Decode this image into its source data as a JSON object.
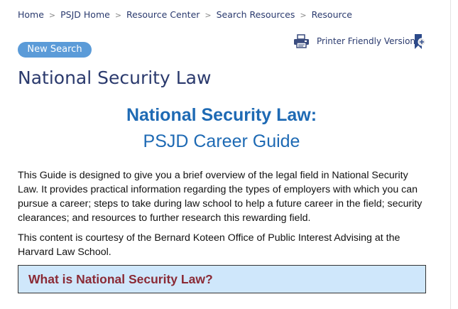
{
  "breadcrumb": {
    "items": [
      {
        "label": "Home"
      },
      {
        "label": "PSJD Home"
      },
      {
        "label": "Resource Center"
      },
      {
        "label": "Search Resources"
      },
      {
        "label": "Resource"
      }
    ],
    "separator": ">"
  },
  "toolbar": {
    "new_search_label": "New Search",
    "printer_label": "Printer Friendly Version",
    "printer_icon": "printer-icon",
    "bookmark_icon": "bookmark-icon"
  },
  "page": {
    "title": "National Security Law"
  },
  "guide": {
    "title": "National Security Law:",
    "subtitle": "PSJD Career Guide",
    "paragraphs": [
      "This Guide is designed to give you a brief overview of the legal field in National Security Law. It provides practical information regarding the types of employers with which you can pursue a career; steps to take during law school to help a future career in the field; security clearances; and resources to further research this rewarding field.",
      "This content is courtesy of the Bernard Koteen Office of Public Interest Advising at the Harvard Law School."
    ],
    "section_heading": "What is National Security Law?"
  },
  "colors": {
    "link": "#2a3a6e",
    "button": "#5b9bd8",
    "guide_title": "#1e6ab4",
    "section_bg": "#cfe7fb",
    "section_heading": "#8a2a35"
  }
}
